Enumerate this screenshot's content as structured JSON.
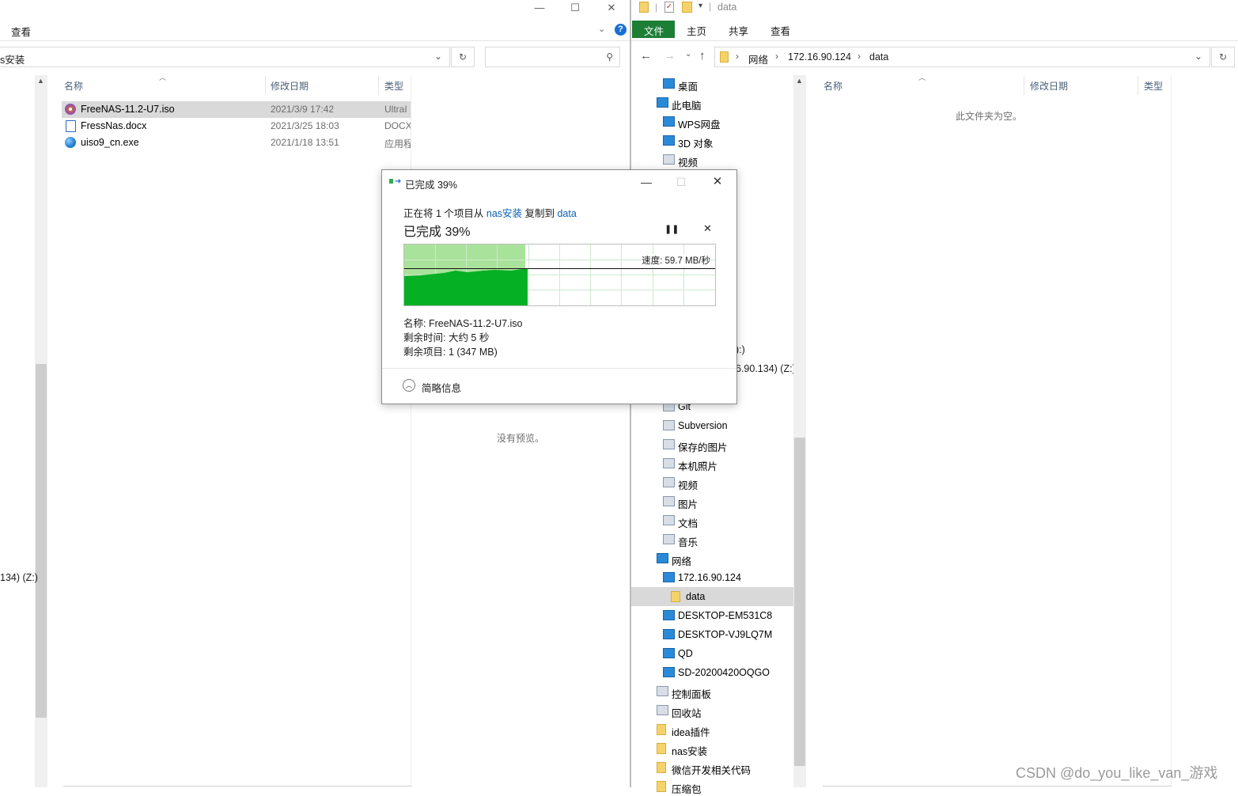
{
  "left_window": {
    "ribbon_view": "查看",
    "address": "s安装",
    "columns": {
      "name": "名称",
      "modified": "修改日期",
      "type": "类型"
    },
    "files": [
      {
        "name": "FreeNAS-11.2-U7.iso",
        "modified": "2021/3/9 17:42",
        "type": "UltraI"
      },
      {
        "name": "FressNas.docx",
        "modified": "2021/3/25 18:03",
        "type": "DOCX"
      },
      {
        "name": "uiso9_cn.exe",
        "modified": "2021/1/18 13:51",
        "type": "应用程"
      }
    ],
    "no_preview": "没有预览。",
    "drive_fragment": "134) (Z:)"
  },
  "right_window": {
    "qat_title": "data",
    "ribbon_tabs": [
      "文件",
      "主页",
      "共享",
      "查看"
    ],
    "breadcrumb": [
      "网络",
      "172.16.90.124",
      "data"
    ],
    "columns": {
      "name": "名称",
      "modified": "修改日期",
      "type": "类型"
    },
    "empty_text": "此文件夹为空。",
    "nav_fragments": [
      "):)",
      "6.90.134) (Z:)"
    ],
    "nav_top": [
      {
        "label": "桌面",
        "icon": "desktop-icon"
      },
      {
        "label": "此电脑",
        "icon": "this-pc-icon"
      },
      {
        "label": "WPS网盘",
        "icon": "cloud-icon"
      },
      {
        "label": "3D 对象",
        "icon": "3d-objects-icon"
      },
      {
        "label": "视频",
        "icon": "video-icon"
      }
    ],
    "nav_bottom": [
      {
        "label": "Git",
        "icon": "network-folder-icon"
      },
      {
        "label": "Subversion",
        "icon": "network-folder-icon"
      },
      {
        "label": "保存的图片",
        "icon": "pictures-icon"
      },
      {
        "label": "本机照片",
        "icon": "pictures-icon"
      },
      {
        "label": "视频",
        "icon": "video-icon"
      },
      {
        "label": "图片",
        "icon": "pictures-icon"
      },
      {
        "label": "文档",
        "icon": "documents-icon"
      },
      {
        "label": "音乐",
        "icon": "music-icon"
      },
      {
        "label": "网络",
        "icon": "network-icon"
      },
      {
        "label": "172.16.90.124",
        "icon": "computer-icon"
      },
      {
        "label": "data",
        "icon": "share-folder-icon"
      },
      {
        "label": "DESKTOP-EM531C8",
        "icon": "computer-icon"
      },
      {
        "label": "DESKTOP-VJ9LQ7M",
        "icon": "computer-icon"
      },
      {
        "label": "QD",
        "icon": "computer-icon"
      },
      {
        "label": "SD-20200420OQGO",
        "icon": "computer-icon"
      },
      {
        "label": "控制面板",
        "icon": "control-panel-icon"
      },
      {
        "label": "回收站",
        "icon": "recycle-bin-icon"
      },
      {
        "label": "idea插件",
        "icon": "folder-icon"
      },
      {
        "label": "nas安装",
        "icon": "folder-icon"
      },
      {
        "label": "微信开发相关代码",
        "icon": "folder-icon"
      },
      {
        "label": "压缩包",
        "icon": "folder-icon"
      }
    ]
  },
  "dialog": {
    "title": "已完成 39%",
    "copy_prefix": "正在将 1 个项目从 ",
    "copy_source": "nas安装",
    "copy_middle": " 复制到 ",
    "copy_dest": "data",
    "heading": "已完成 39%",
    "progress_percent": 39,
    "speed": "速度: 59.7 MB/秒",
    "name_line": "名称: FreeNAS-11.2-U7.iso",
    "remaining_time": "剩余时间: 大约 5 秒",
    "remaining_items": "剩余项目: 1 (347 MB)",
    "less_details": "简略信息"
  },
  "watermark": "CSDN @do_you_like_van_游戏"
}
